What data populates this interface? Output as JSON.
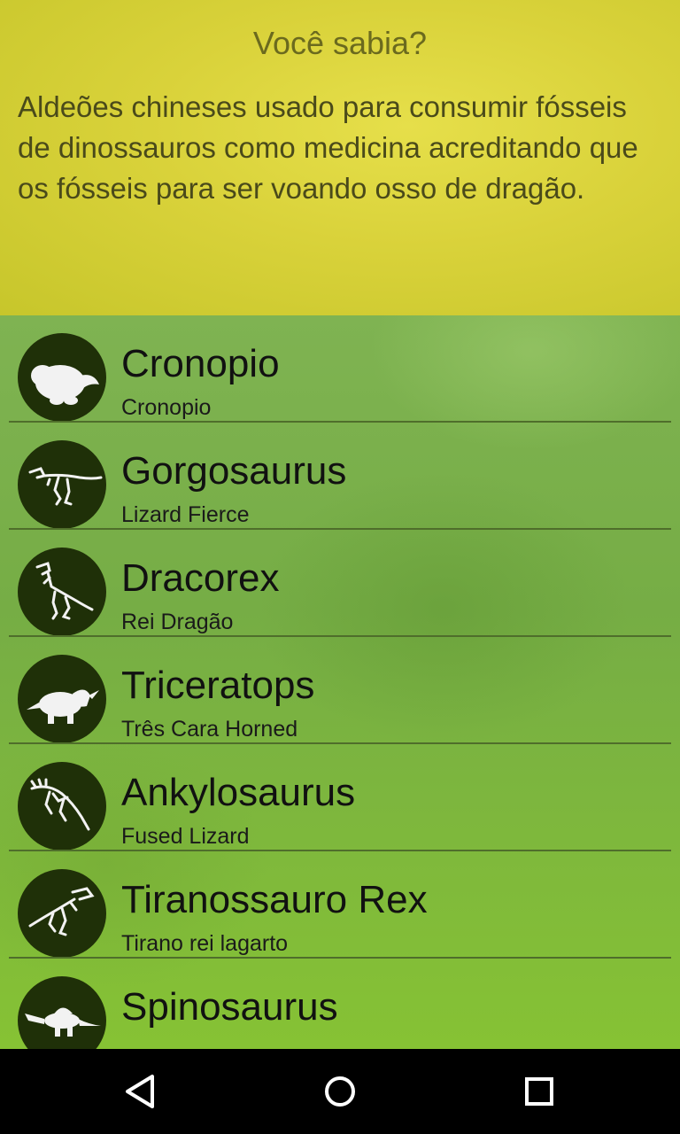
{
  "fact": {
    "title": "Você sabia?",
    "body": "Aldeões chineses usado para consumir fósseis de dinossauros como medicina acreditando que os fósseis para ser voando osso de dragão."
  },
  "dinosaurs": [
    {
      "name": "Cronopio",
      "subtitle": "Cronopio",
      "icon": "cronopio-silhouette-icon"
    },
    {
      "name": "Gorgosaurus",
      "subtitle": "Lizard Fierce",
      "icon": "gorgosaurus-skeleton-icon"
    },
    {
      "name": "Dracorex",
      "subtitle": "Rei Dragão",
      "icon": "dracorex-skeleton-icon"
    },
    {
      "name": "Triceratops",
      "subtitle": "Três Cara Horned",
      "icon": "triceratops-silhouette-icon"
    },
    {
      "name": "Ankylosaurus",
      "subtitle": "Fused Lizard",
      "icon": "ankylosaurus-skeleton-icon"
    },
    {
      "name": "Tiranossauro Rex",
      "subtitle": "Tirano rei lagarto",
      "icon": "trex-skeleton-icon"
    },
    {
      "name": "Spinosaurus",
      "subtitle": "",
      "icon": "spinosaurus-silhouette-icon"
    }
  ],
  "navbar": {
    "back_icon": "back-triangle-icon",
    "home_icon": "home-circle-icon",
    "recents_icon": "recents-square-icon"
  },
  "colors": {
    "fact_bg": "#dcd43c",
    "list_bg": "#7fb352",
    "avatar_bg": "#1f3008",
    "divider": "#4f6e2b"
  }
}
